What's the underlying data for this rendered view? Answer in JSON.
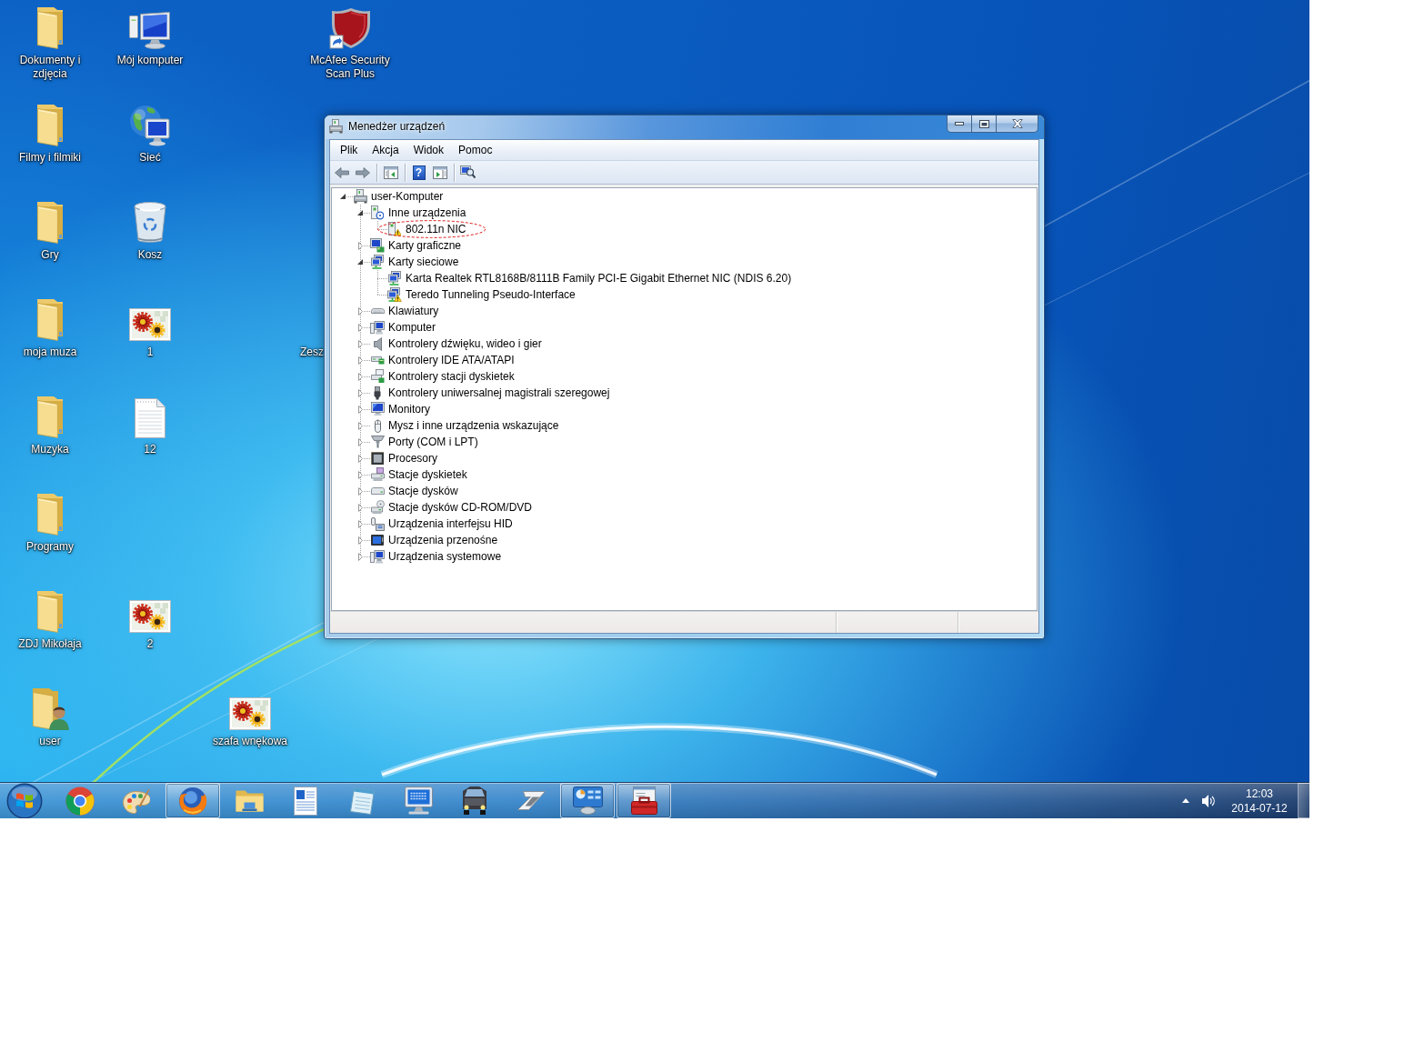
{
  "desktop": {
    "icons": [
      {
        "label": "Dokumenty i zdjęcia",
        "kind": "folder"
      },
      {
        "label": "Filmy i filmiki",
        "kind": "folder"
      },
      {
        "label": "Gry",
        "kind": "folder"
      },
      {
        "label": "moja muza",
        "kind": "folder"
      },
      {
        "label": "Muzyka",
        "kind": "folder"
      },
      {
        "label": "Programy",
        "kind": "folder"
      },
      {
        "label": "ZDJ Mikołaja",
        "kind": "folder"
      },
      {
        "label": "user",
        "kind": "userfolder"
      },
      {
        "label": "Mój komputer",
        "kind": "computer"
      },
      {
        "label": "Sieć",
        "kind": "network"
      },
      {
        "label": "Kosz",
        "kind": "recyclebin"
      },
      {
        "label": "1",
        "kind": "image"
      },
      {
        "label": "12",
        "kind": "textfile"
      },
      {
        "label": "2",
        "kind": "image"
      },
      {
        "label": "szafa wnękowa",
        "kind": "image"
      },
      {
        "label": "McAfee Security Scan Plus",
        "kind": "shieldshortcut"
      },
      {
        "label": "Zesz",
        "kind": "covered"
      }
    ]
  },
  "window": {
    "title": "Menedżer urządzeń",
    "menu": [
      "Plik",
      "Akcja",
      "Widok",
      "Pomoc"
    ],
    "toolbar": [
      {
        "kind": "back"
      },
      {
        "kind": "forward"
      },
      {
        "kind": "separator"
      },
      {
        "kind": "consoletree"
      },
      {
        "kind": "separator"
      },
      {
        "kind": "help",
        "label": "?"
      },
      {
        "kind": "actionpane"
      },
      {
        "kind": "separator"
      },
      {
        "kind": "scan"
      }
    ],
    "tree": {
      "label": "user-Komputer",
      "kind": "pc",
      "expanded": true,
      "selected": false,
      "warning": false,
      "circled": false,
      "children": [
        {
          "label": "Inne urządzenia",
          "kind": "unknown",
          "expanded": true,
          "selected": false,
          "warning": false,
          "circled": false,
          "children": [
            {
              "label": "802.11n NIC",
              "kind": "device",
              "selected": false,
              "warning": true,
              "circled": true
            }
          ]
        },
        {
          "label": "Karty graficzne",
          "kind": "display",
          "expanded": false,
          "selected": false,
          "warning": false,
          "circled": false
        },
        {
          "label": "Karty sieciowe",
          "kind": "network",
          "expanded": true,
          "selected": false,
          "warning": false,
          "circled": false,
          "children": [
            {
              "label": "Karta Realtek RTL8168B/8111B Family PCI-E Gigabit Ethernet NIC (NDIS 6.20)",
              "kind": "network",
              "selected": false,
              "warning": false,
              "circled": false
            },
            {
              "label": "Teredo Tunneling Pseudo-Interface",
              "kind": "network",
              "selected": false,
              "warning": true,
              "circled": false
            }
          ]
        },
        {
          "label": "Klawiatury",
          "kind": "keyboard",
          "expanded": false,
          "selected": false,
          "warning": false,
          "circled": false
        },
        {
          "label": "Komputer",
          "kind": "computer",
          "expanded": false,
          "selected": false,
          "warning": false,
          "circled": false
        },
        {
          "label": "Kontrolery dźwięku, wideo i gier",
          "kind": "sound",
          "expanded": false,
          "selected": false,
          "warning": false,
          "circled": false
        },
        {
          "label": "Kontrolery IDE ATA/ATAPI",
          "kind": "ide",
          "expanded": false,
          "selected": false,
          "warning": false,
          "circled": false
        },
        {
          "label": "Kontrolery stacji dyskietek",
          "kind": "floppyctl",
          "expanded": false,
          "selected": false,
          "warning": false,
          "circled": false
        },
        {
          "label": "Kontrolery uniwersalnej magistrali szeregowej",
          "kind": "usb",
          "expanded": false,
          "selected": false,
          "warning": false,
          "circled": false
        },
        {
          "label": "Monitory",
          "kind": "monitor",
          "expanded": false,
          "selected": false,
          "warning": false,
          "circled": false
        },
        {
          "label": "Mysz i inne urządzenia wskazujące",
          "kind": "mouse",
          "expanded": false,
          "selected": false,
          "warning": false,
          "circled": false
        },
        {
          "label": "Porty (COM i LPT)",
          "kind": "port",
          "expanded": false,
          "selected": false,
          "warning": false,
          "circled": false
        },
        {
          "label": "Procesory",
          "kind": "processor",
          "expanded": false,
          "selected": false,
          "warning": false,
          "circled": false
        },
        {
          "label": "Stacje dyskietek",
          "kind": "floppy",
          "expanded": false,
          "selected": false,
          "warning": false,
          "circled": false
        },
        {
          "label": "Stacje dysków",
          "kind": "disk",
          "expanded": false,
          "selected": false,
          "warning": false,
          "circled": false
        },
        {
          "label": "Stacje dysków CD-ROM/DVD",
          "kind": "cdrom",
          "expanded": false,
          "selected": false,
          "warning": false,
          "circled": false
        },
        {
          "label": "Urządzenia interfejsu HID",
          "kind": "hid",
          "expanded": false,
          "selected": false,
          "warning": false,
          "circled": false
        },
        {
          "label": "Urządzenia przenośne",
          "kind": "portable",
          "expanded": false,
          "selected": false,
          "warning": false,
          "circled": false
        },
        {
          "label": "Urządzenia systemowe",
          "kind": "system",
          "expanded": false,
          "selected": false,
          "warning": false,
          "circled": false
        }
      ]
    }
  },
  "taskbar": {
    "items": [
      {
        "kind": "ringball",
        "running": false
      },
      {
        "kind": "palette",
        "running": false
      },
      {
        "kind": "foxglobe",
        "running": true
      },
      {
        "kind": "folder",
        "running": false
      },
      {
        "kind": "document",
        "running": false
      },
      {
        "kind": "notepad",
        "running": false
      },
      {
        "kind": "terminal",
        "running": false
      },
      {
        "kind": "truck",
        "running": false
      },
      {
        "kind": "swoosh",
        "running": false
      },
      {
        "kind": "panel",
        "running": true
      },
      {
        "kind": "toolbox",
        "running": true
      }
    ],
    "clock": {
      "time": "12:03",
      "date": "2014-07-12"
    }
  }
}
